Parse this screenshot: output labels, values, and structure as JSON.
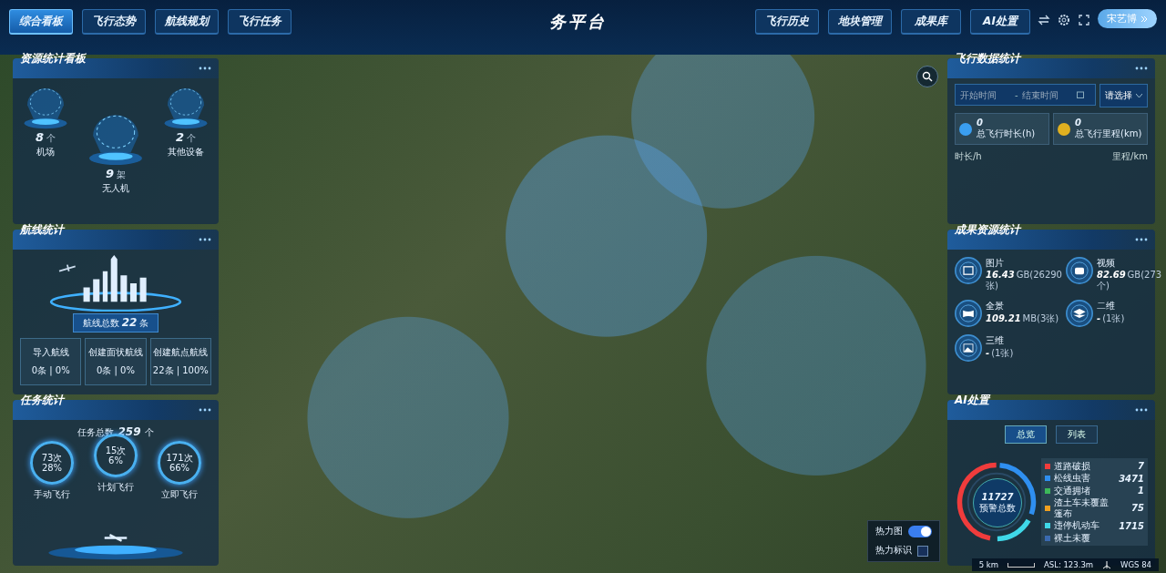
{
  "header": {
    "title": "务平台",
    "left_tabs": [
      {
        "label": "综合看板",
        "selected": true
      },
      {
        "label": "飞行态势",
        "selected": false
      },
      {
        "label": "航线规划",
        "selected": false
      },
      {
        "label": "飞行任务",
        "selected": false
      }
    ],
    "right_tabs": [
      {
        "label": "飞行历史",
        "selected": false
      },
      {
        "label": "地块管理",
        "selected": false
      },
      {
        "label": "成果库",
        "selected": false
      },
      {
        "label": "AI处置",
        "selected": false
      }
    ],
    "user": {
      "name": "宋艺博"
    }
  },
  "resource_panel": {
    "title": "资源统计看板",
    "items": [
      {
        "value": "8",
        "unit": "个",
        "label": "机场"
      },
      {
        "value": "9",
        "unit": "架",
        "label": "无人机"
      },
      {
        "value": "2",
        "unit": "个",
        "label": "其他设备"
      }
    ]
  },
  "route_panel": {
    "title": "航线统计",
    "total_label": "航线总数",
    "total": "22",
    "total_unit": "条",
    "cards": [
      {
        "label": "导入航线",
        "value": "0条 | 0%"
      },
      {
        "label": "创建面状航线",
        "value": "0条 | 0%"
      },
      {
        "label": "创建航点航线",
        "value": "22条 | 100%"
      }
    ]
  },
  "task_panel": {
    "title": "任务统计",
    "total_label": "任务总数",
    "total": "259",
    "total_unit": "个",
    "items": [
      {
        "count": "73次",
        "percent": "28%",
        "label": "手动飞行"
      },
      {
        "count": "15次",
        "percent": "6%",
        "label": "计划飞行"
      },
      {
        "count": "171次",
        "percent": "66%",
        "label": "立即飞行"
      }
    ]
  },
  "flight_panel": {
    "title": "飞行数据统计",
    "start_placeholder": "开始时间",
    "separator": "-",
    "end_placeholder": "结束时间",
    "select_placeholder": "请选择",
    "stats": [
      {
        "kind": "time",
        "value": "0",
        "label": "总飞行时长(h)"
      },
      {
        "kind": "distance",
        "value": "0",
        "label": "总飞行里程(km)"
      }
    ],
    "axis_left": "时长/h",
    "axis_right": "里程/km"
  },
  "results_panel": {
    "title": "成果资源统计",
    "items": [
      {
        "kind": "photo",
        "label": "图片",
        "value": "16.43",
        "detail": "GB(26290张)"
      },
      {
        "kind": "video",
        "label": "视频",
        "value": "82.69",
        "detail": "GB(273个)"
      },
      {
        "kind": "panorama",
        "label": "全景",
        "value": "109.21",
        "detail": "MB(3张)"
      },
      {
        "kind": "flat",
        "label": "二维",
        "value": "-",
        "detail": "(1张)"
      },
      {
        "kind": "solid",
        "label": "三维",
        "value": "-",
        "detail": "(1张)"
      }
    ]
  },
  "ai_panel": {
    "title": "AI处置",
    "tabs": [
      {
        "label": "总览",
        "selected": true
      },
      {
        "label": "列表",
        "selected": false
      }
    ],
    "total": "11727",
    "total_label": "预警总数",
    "legend": [
      {
        "label": "道路破损",
        "value": "7",
        "color": "#f03c3c"
      },
      {
        "label": "松线虫害",
        "value": "3471",
        "color": "#2f8ff0"
      },
      {
        "label": "交通拥堵",
        "value": "1",
        "color": "#3cb85a"
      },
      {
        "label": "渣土车未覆盖篷布",
        "value": "75",
        "color": "#f0a020"
      },
      {
        "label": "违停机动车",
        "value": "1715",
        "color": "#3fd8e8"
      },
      {
        "label": "裸土未覆",
        "color": "#3a6ab0"
      }
    ]
  },
  "map": {
    "heat_layers": [
      {
        "kind": "switch",
        "label": "热力图",
        "on": true
      },
      {
        "kind": "checkbox",
        "label": "热力标识",
        "on": false
      }
    ],
    "scale": "5 km",
    "altitude": "ASL: 123.3m",
    "datum": "WGS 84"
  }
}
